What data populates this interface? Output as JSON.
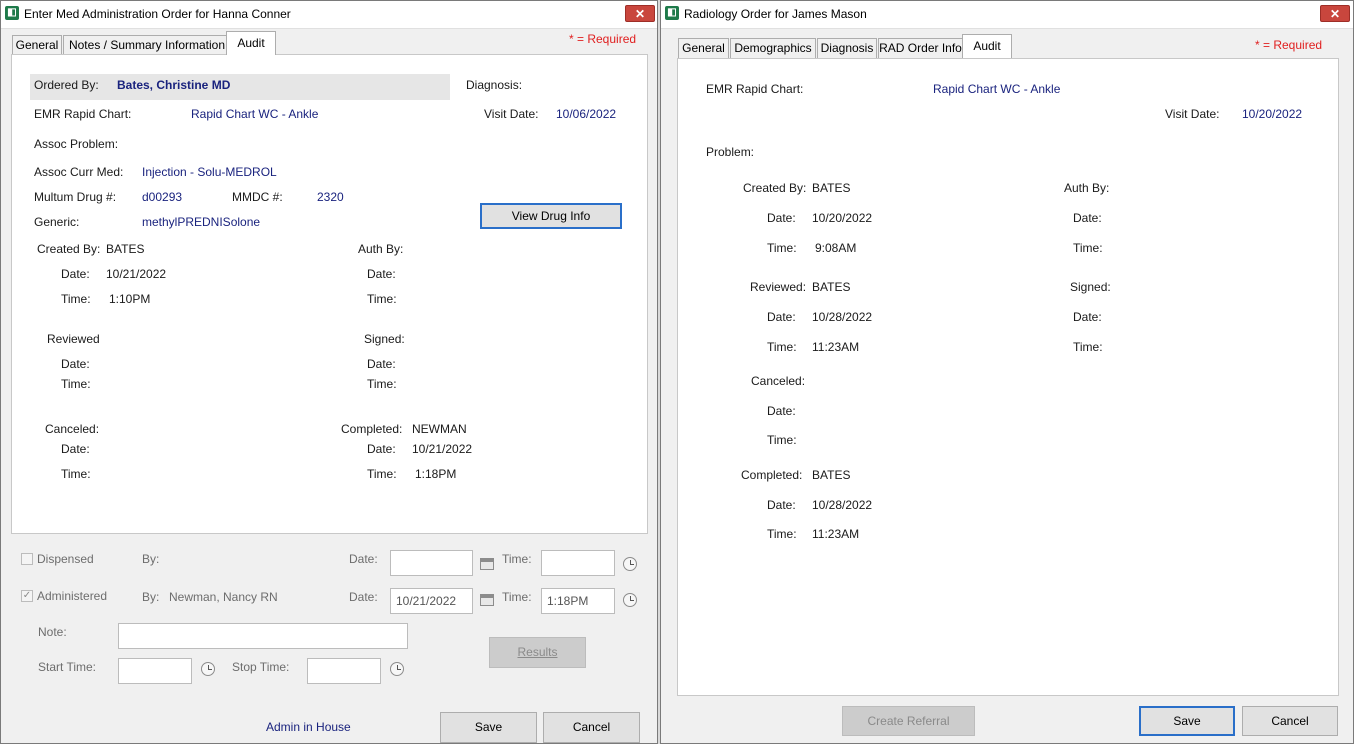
{
  "left_window": {
    "title": "Enter Med Administration Order for Hanna Conner",
    "close": "✕",
    "tabs": [
      "General",
      "Notes / Summary Information",
      "Audit"
    ],
    "required": "* = Required",
    "ordered_by_label": "Ordered By:",
    "ordered_by_value": "Bates, Christine  MD",
    "diagnosis_label": "Diagnosis:",
    "emr_label": "EMR Rapid Chart:",
    "emr_value": "Rapid Chart WC - Ankle",
    "visit_date_label": "Visit Date:",
    "visit_date_value": "10/06/2022",
    "assoc_problem_label": "Assoc Problem:",
    "assoc_med_label": "Assoc Curr Med:",
    "assoc_med_value": "Injection - Solu-MEDROL",
    "multum_label": "Multum Drug #:",
    "multum_value": "d00293",
    "mmdc_label": "MMDC #:",
    "mmdc_value": "2320",
    "generic_label": "Generic:",
    "generic_value": "methylPREDNISolone",
    "view_drug_button": "View Drug Info",
    "audit": {
      "created_by_label": "Created By:",
      "created_by_value": "BATES",
      "created_date_label": "Date:",
      "created_date_value": "10/21/2022",
      "created_time_label": "Time:",
      "created_time_value": "1:10PM",
      "auth_by_label": "Auth By:",
      "auth_date_label": "Date:",
      "auth_time_label": "Time:",
      "reviewed_label": "Reviewed",
      "reviewed_date_label": "Date:",
      "reviewed_time_label": "Time:",
      "signed_label": "Signed:",
      "signed_date_label": "Date:",
      "signed_time_label": "Time:",
      "canceled_label": "Canceled:",
      "canceled_date_label": "Date:",
      "canceled_time_label": "Time:",
      "completed_label": "Completed:",
      "completed_value": "NEWMAN",
      "completed_date_label": "Date:",
      "completed_date_value": "10/21/2022",
      "completed_time_label": "Time:",
      "completed_time_value": "1:18PM"
    },
    "dispensed": {
      "label": "Dispensed",
      "by_label": "By:",
      "date_label": "Date:",
      "date_value": "",
      "time_label": "Time:",
      "time_value": ""
    },
    "administered": {
      "label": "Administered",
      "by_label": "By:",
      "by_value": "Newman, Nancy  RN",
      "date_label": "Date:",
      "date_value": "10/21/2022",
      "time_label": "Time:",
      "time_value": "1:18PM",
      "check": "✓"
    },
    "note_label": "Note:",
    "note_value": "",
    "start_time_label": "Start Time:",
    "start_time_value": "",
    "stop_time_label": "Stop Time:",
    "stop_time_value": "",
    "results_button": "Results",
    "admin_in_house": "Admin in House",
    "save_button": "Save",
    "cancel_button": "Cancel"
  },
  "right_window": {
    "title": "Radiology Order for James Mason",
    "close": "✕",
    "tabs": [
      "General",
      "Demographics",
      "Diagnosis",
      "RAD Order Info",
      "Audit"
    ],
    "required": "* = Required",
    "emr_label": "EMR Rapid Chart:",
    "emr_value": "Rapid Chart WC - Ankle",
    "visit_date_label": "Visit Date:",
    "visit_date_value": "10/20/2022",
    "problem_label": "Problem:",
    "audit": {
      "created_by_label": "Created By:",
      "created_by_value": "BATES",
      "created_date_label": "Date:",
      "created_date_value": "10/20/2022",
      "created_time_label": "Time:",
      "created_time_value": "9:08AM",
      "auth_by_label": "Auth By:",
      "auth_date_label": "Date:",
      "auth_time_label": "Time:",
      "reviewed_label": "Reviewed:",
      "reviewed_value": "BATES",
      "reviewed_date_label": "Date:",
      "reviewed_date_value": "10/28/2022",
      "reviewed_time_label": "Time:",
      "reviewed_time_value": "11:23AM",
      "signed_label": "Signed:",
      "signed_date_label": "Date:",
      "signed_time_label": "Time:",
      "canceled_label": "Canceled:",
      "canceled_date_label": "Date:",
      "canceled_time_label": "Time:",
      "completed_label": "Completed:",
      "completed_value": "BATES",
      "completed_date_label": "Date:",
      "completed_date_value": "10/28/2022",
      "completed_time_label": "Time:",
      "completed_time_value": "11:23AM"
    },
    "create_referral_button": "Create Referral",
    "save_button": "Save",
    "cancel_button": "Cancel"
  },
  "colors": {
    "value_text": "#1a237e",
    "required": "#e02020",
    "close_button": "#c9463d",
    "primary_border": "#2a6fc9"
  },
  "icons": [
    "app-icon",
    "close-icon",
    "calendar-icon",
    "clock-icon",
    "checkbox-icon"
  ]
}
